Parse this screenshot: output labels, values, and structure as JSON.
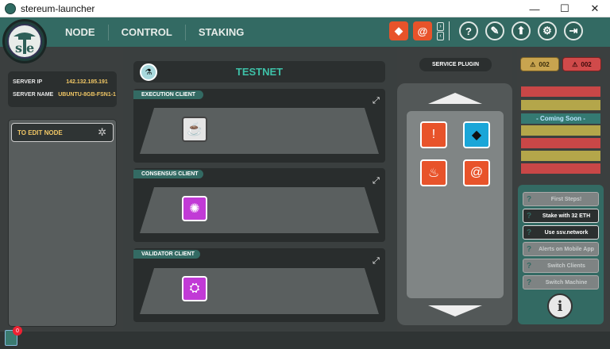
{
  "window": {
    "title": "stereum-launcher",
    "minimize": "—",
    "maximize": "☐",
    "close": "✕"
  },
  "nav": {
    "items": [
      "NODE",
      "CONTROL",
      "STAKING"
    ]
  },
  "server": {
    "ip_label": "SERVER IP",
    "ip_value": "142.132.185.191",
    "name_label": "SERVER NAME",
    "name_value": "UBUNTU-8GB-FSN1-1"
  },
  "edit_node": {
    "label": "TO EDIT NODE"
  },
  "network": {
    "name": "TESTNET"
  },
  "sections": [
    {
      "label": "EXECUTION CLIENT"
    },
    {
      "label": "CONSENSUS CLIENT"
    },
    {
      "label": "VALIDATOR CLIENT"
    }
  ],
  "plugin": {
    "label": "SERVICE PLUGIN"
  },
  "alerts": {
    "warning_count": "002",
    "error_count": "002"
  },
  "status": {
    "coming_soon": "- Coming Soon -"
  },
  "help": {
    "items": [
      "First Steps!",
      "Stake with 32 ETH",
      "Use ssv.network",
      "Alerts on Mobile App",
      "Switch Clients",
      "Switch Machine"
    ]
  },
  "notifications": {
    "count": "0"
  },
  "colors": {
    "header": "#336a63",
    "accent_teal": "#3ec1a8",
    "label_yellow": "#f1c765",
    "plugin_orange": "#e8532a",
    "client_purple": "#c13ad6"
  }
}
